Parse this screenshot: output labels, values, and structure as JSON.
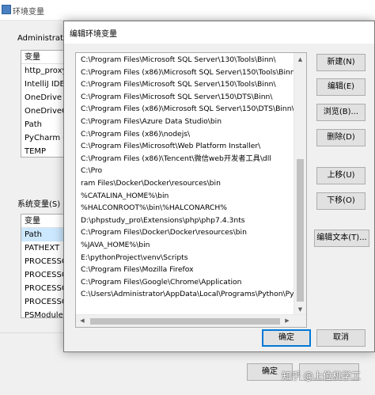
{
  "background_window": {
    "title": "环境变量",
    "user_section_label": "Administrator",
    "user_vars": [
      "变量",
      "http_proxy",
      "IntelliJ IDEA",
      "OneDrive",
      "OneDriveCo",
      "Path",
      "PyCharm Co",
      "TEMP"
    ],
    "system_section_label": "系统变量(S)",
    "system_vars": [
      "变量",
      "Path",
      "PATHEXT",
      "PROCESSOR",
      "PROCESSOR",
      "PROCESSOR",
      "PROCESSOR",
      "PSModulePa"
    ],
    "ok_label": "确定"
  },
  "dialog": {
    "title": "编辑环境变量",
    "paths": [
      "C:\\Program Files\\Microsoft SQL Server\\130\\Tools\\Binn\\",
      "C:\\Program Files (x86)\\Microsoft SQL Server\\150\\Tools\\Binn\\",
      "C:\\Program Files\\Microsoft SQL Server\\150\\Tools\\Binn\\",
      "C:\\Program Files\\Microsoft SQL Server\\150\\DTS\\Binn\\",
      "C:\\Program Files (x86)\\Microsoft SQL Server\\150\\DTS\\Binn\\",
      "C:\\Program Files\\Azure Data Studio\\bin",
      "C:\\Program Files (x86)\\nodejs\\",
      "C:\\Program Files\\Microsoft\\Web Platform Installer\\",
      "C:\\Program Files (x86)\\Tencent\\微信web开发者工具\\dll",
      "C:\\Pro",
      "ram Files\\Docker\\Docker\\resources\\bin",
      "%CATALINA_HOME%\\bin",
      "%HALCONROOT%\\bin\\%HALCONARCH%",
      "D:\\phpstudy_pro\\Extensions\\php\\php7.4.3nts",
      "C:\\Program Files\\Docker\\Docker\\resources\\bin",
      "%JAVA_HOME%\\bin",
      "E:\\pythonProject\\venv\\Scripts",
      "C:\\Program Files\\Mozilla Firefox",
      "C:\\Program Files\\Google\\Chrome\\Application",
      "C:\\Users\\Administrator\\AppData\\Local\\Programs\\Python\\Pyt..."
    ],
    "buttons": {
      "new": "新建(N)",
      "edit": "编辑(E)",
      "browse": "浏览(B)...",
      "delete": "删除(D)",
      "move_up": "上移(U)",
      "move_down": "下移(O)",
      "edit_text": "编辑文本(T)...",
      "ok": "确定",
      "cancel": "取消"
    }
  },
  "watermark": "知乎 @上位机学工"
}
